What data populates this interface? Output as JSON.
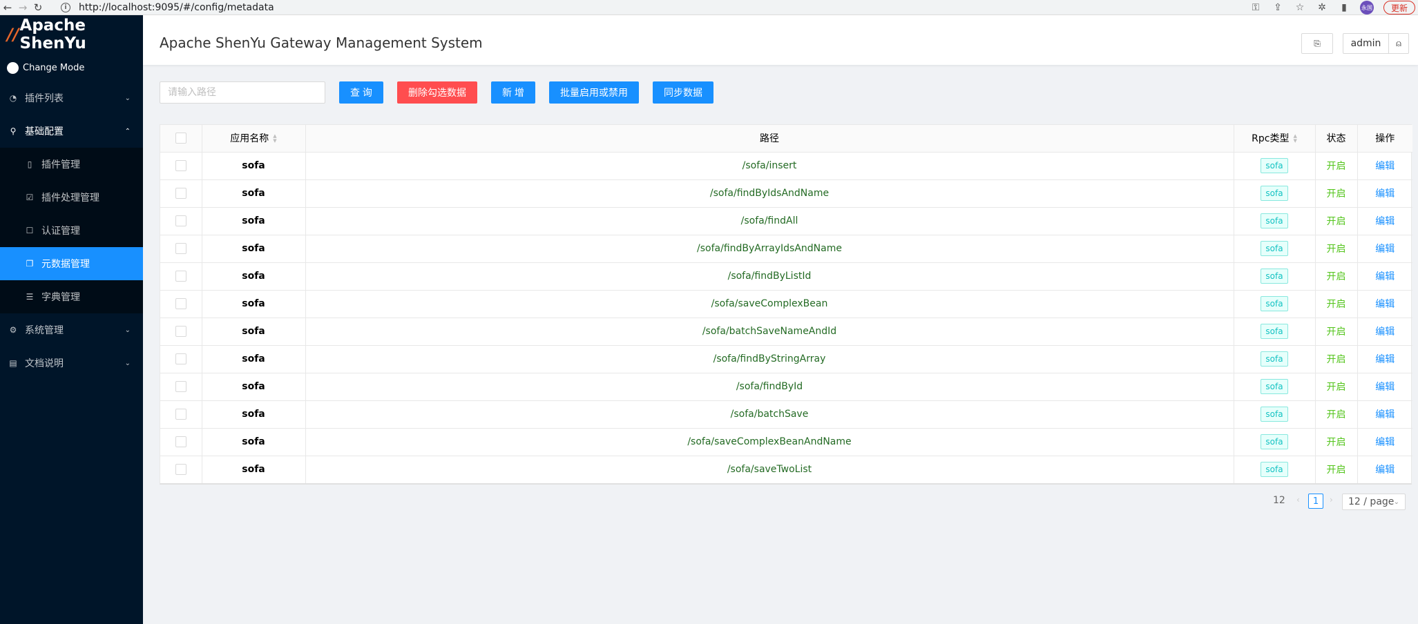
{
  "browser": {
    "url": "http://localhost:9095/#/config/metadata",
    "update_label": "更新",
    "profile_label": "永国"
  },
  "sidebar": {
    "logo_text": "Apache ShenYu",
    "change_mode": "Change Mode",
    "menu": [
      {
        "label": "插件列表",
        "icon": "dashboard-icon"
      },
      {
        "label": "基础配置",
        "icon": "setting-icon",
        "open": true
      },
      {
        "label": "系统管理",
        "icon": "gear-icon"
      },
      {
        "label": "文档说明",
        "icon": "file-icon"
      }
    ],
    "submenu": [
      {
        "label": "插件管理",
        "icon": "book-icon"
      },
      {
        "label": "插件处理管理",
        "icon": "check-square-icon"
      },
      {
        "label": "认证管理",
        "icon": "audit-icon"
      },
      {
        "label": "元数据管理",
        "icon": "snippets-icon",
        "active": true
      },
      {
        "label": "字典管理",
        "icon": "list-icon"
      }
    ]
  },
  "header": {
    "title": "Apache ShenYu Gateway Management System",
    "user": "admin"
  },
  "toolbar": {
    "search_placeholder": "请输入路径",
    "query_label": "查 询",
    "delete_label": "删除勾选数据",
    "add_label": "新 增",
    "batch_label": "批量启用或禁用",
    "sync_label": "同步数据"
  },
  "table": {
    "columns": {
      "app_name": "应用名称",
      "path": "路径",
      "rpc_type": "Rpc类型",
      "status": "状态",
      "action": "操作"
    },
    "rows": [
      {
        "app": "sofa",
        "path": "/sofa/insert",
        "rpc": "sofa",
        "status": "开启",
        "action": "编辑"
      },
      {
        "app": "sofa",
        "path": "/sofa/findByIdsAndName",
        "rpc": "sofa",
        "status": "开启",
        "action": "编辑"
      },
      {
        "app": "sofa",
        "path": "/sofa/findAll",
        "rpc": "sofa",
        "status": "开启",
        "action": "编辑"
      },
      {
        "app": "sofa",
        "path": "/sofa/findByArrayIdsAndName",
        "rpc": "sofa",
        "status": "开启",
        "action": "编辑"
      },
      {
        "app": "sofa",
        "path": "/sofa/findByListId",
        "rpc": "sofa",
        "status": "开启",
        "action": "编辑"
      },
      {
        "app": "sofa",
        "path": "/sofa/saveComplexBean",
        "rpc": "sofa",
        "status": "开启",
        "action": "编辑"
      },
      {
        "app": "sofa",
        "path": "/sofa/batchSaveNameAndId",
        "rpc": "sofa",
        "status": "开启",
        "action": "编辑"
      },
      {
        "app": "sofa",
        "path": "/sofa/findByStringArray",
        "rpc": "sofa",
        "status": "开启",
        "action": "编辑"
      },
      {
        "app": "sofa",
        "path": "/sofa/findById",
        "rpc": "sofa",
        "status": "开启",
        "action": "编辑"
      },
      {
        "app": "sofa",
        "path": "/sofa/batchSave",
        "rpc": "sofa",
        "status": "开启",
        "action": "编辑"
      },
      {
        "app": "sofa",
        "path": "/sofa/saveComplexBeanAndName",
        "rpc": "sofa",
        "status": "开启",
        "action": "编辑"
      },
      {
        "app": "sofa",
        "path": "/sofa/saveTwoList",
        "rpc": "sofa",
        "status": "开启",
        "action": "编辑"
      }
    ]
  },
  "pagination": {
    "total": "12",
    "current": "1",
    "page_size": "12 / page"
  },
  "colors": {
    "primary": "#1890ff",
    "danger": "#ff4d4f",
    "sidebar_bg": "#001529",
    "status_on": "#52c41a",
    "tag_cyan": "#13c2c2"
  }
}
